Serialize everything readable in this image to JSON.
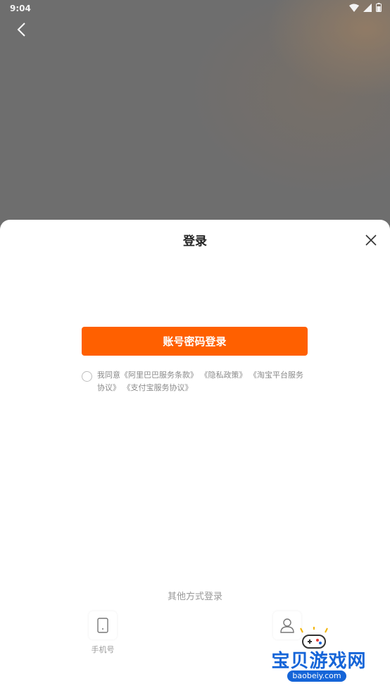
{
  "status_bar": {
    "time": "9:04"
  },
  "sheet": {
    "title": "登录",
    "login_button": "账号密码登录",
    "agreement": {
      "prefix": "我同意",
      "links": [
        "《阿里巴巴服务条款》",
        "《隐私政策》",
        "《淘宝平台服务协议》",
        "《支付宝服务协议》"
      ]
    },
    "other_methods": {
      "title": "其他方式登录",
      "items": [
        {
          "label": "手机号",
          "icon": "phone-icon"
        },
        {
          "label": "",
          "icon": "user-icon"
        }
      ]
    }
  },
  "watermark": {
    "text": "宝贝游戏网",
    "url": "baobeiy.com"
  },
  "colors": {
    "accent": "#ff6000",
    "watermark": "#1565d8"
  }
}
